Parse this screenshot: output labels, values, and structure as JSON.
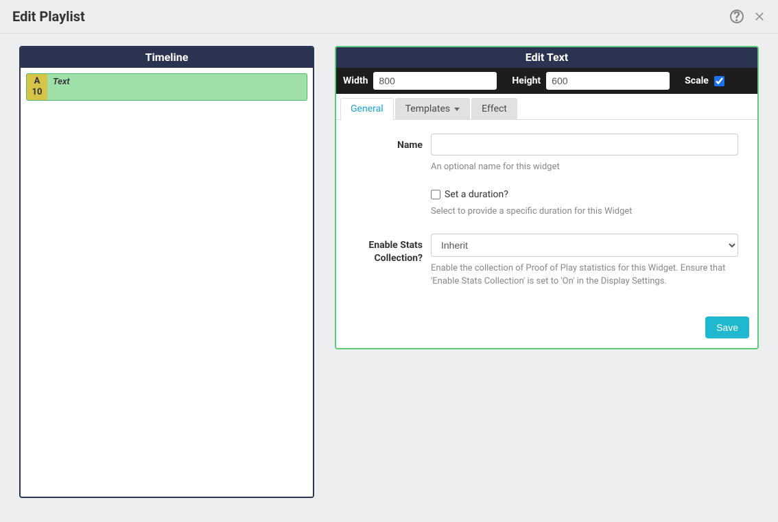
{
  "header": {
    "title": "Edit Playlist"
  },
  "timeline": {
    "title": "Timeline",
    "items": [
      {
        "letter": "A",
        "duration": "10",
        "label": "Text"
      }
    ]
  },
  "editor": {
    "title": "Edit Text",
    "dimensions": {
      "width_label": "Width",
      "width_value": "800",
      "height_label": "Height",
      "height_value": "600",
      "scale_label": "Scale",
      "scale_checked": true
    },
    "tabs": {
      "general": "General",
      "templates": "Templates",
      "effect": "Effect"
    },
    "fields": {
      "name": {
        "label": "Name",
        "value": "",
        "help": "An optional name for this widget"
      },
      "duration": {
        "checkbox_label": "Set a duration?",
        "checked": false,
        "help": "Select to provide a specific duration for this Widget"
      },
      "stats": {
        "label": "Enable Stats Collection?",
        "selected": "Inherit",
        "help": "Enable the collection of Proof of Play statistics for this Widget. Ensure that 'Enable Stats Collection' is set to 'On' in the Display Settings."
      }
    },
    "buttons": {
      "save": "Save"
    }
  }
}
